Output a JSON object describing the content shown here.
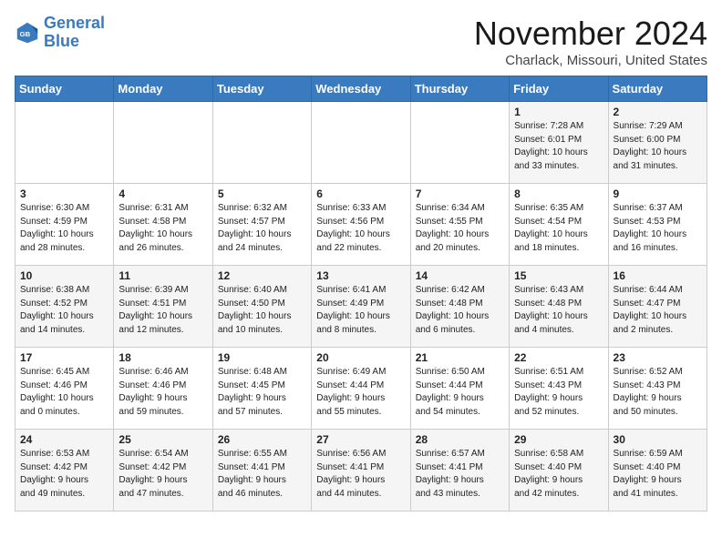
{
  "logo": {
    "line1": "General",
    "line2": "Blue"
  },
  "title": "November 2024",
  "location": "Charlack, Missouri, United States",
  "days_of_week": [
    "Sunday",
    "Monday",
    "Tuesday",
    "Wednesday",
    "Thursday",
    "Friday",
    "Saturday"
  ],
  "weeks": [
    [
      {
        "day": "",
        "info": ""
      },
      {
        "day": "",
        "info": ""
      },
      {
        "day": "",
        "info": ""
      },
      {
        "day": "",
        "info": ""
      },
      {
        "day": "",
        "info": ""
      },
      {
        "day": "1",
        "info": "Sunrise: 7:28 AM\nSunset: 6:01 PM\nDaylight: 10 hours\nand 33 minutes."
      },
      {
        "day": "2",
        "info": "Sunrise: 7:29 AM\nSunset: 6:00 PM\nDaylight: 10 hours\nand 31 minutes."
      }
    ],
    [
      {
        "day": "3",
        "info": "Sunrise: 6:30 AM\nSunset: 4:59 PM\nDaylight: 10 hours\nand 28 minutes."
      },
      {
        "day": "4",
        "info": "Sunrise: 6:31 AM\nSunset: 4:58 PM\nDaylight: 10 hours\nand 26 minutes."
      },
      {
        "day": "5",
        "info": "Sunrise: 6:32 AM\nSunset: 4:57 PM\nDaylight: 10 hours\nand 24 minutes."
      },
      {
        "day": "6",
        "info": "Sunrise: 6:33 AM\nSunset: 4:56 PM\nDaylight: 10 hours\nand 22 minutes."
      },
      {
        "day": "7",
        "info": "Sunrise: 6:34 AM\nSunset: 4:55 PM\nDaylight: 10 hours\nand 20 minutes."
      },
      {
        "day": "8",
        "info": "Sunrise: 6:35 AM\nSunset: 4:54 PM\nDaylight: 10 hours\nand 18 minutes."
      },
      {
        "day": "9",
        "info": "Sunrise: 6:37 AM\nSunset: 4:53 PM\nDaylight: 10 hours\nand 16 minutes."
      }
    ],
    [
      {
        "day": "10",
        "info": "Sunrise: 6:38 AM\nSunset: 4:52 PM\nDaylight: 10 hours\nand 14 minutes."
      },
      {
        "day": "11",
        "info": "Sunrise: 6:39 AM\nSunset: 4:51 PM\nDaylight: 10 hours\nand 12 minutes."
      },
      {
        "day": "12",
        "info": "Sunrise: 6:40 AM\nSunset: 4:50 PM\nDaylight: 10 hours\nand 10 minutes."
      },
      {
        "day": "13",
        "info": "Sunrise: 6:41 AM\nSunset: 4:49 PM\nDaylight: 10 hours\nand 8 minutes."
      },
      {
        "day": "14",
        "info": "Sunrise: 6:42 AM\nSunset: 4:48 PM\nDaylight: 10 hours\nand 6 minutes."
      },
      {
        "day": "15",
        "info": "Sunrise: 6:43 AM\nSunset: 4:48 PM\nDaylight: 10 hours\nand 4 minutes."
      },
      {
        "day": "16",
        "info": "Sunrise: 6:44 AM\nSunset: 4:47 PM\nDaylight: 10 hours\nand 2 minutes."
      }
    ],
    [
      {
        "day": "17",
        "info": "Sunrise: 6:45 AM\nSunset: 4:46 PM\nDaylight: 10 hours\nand 0 minutes."
      },
      {
        "day": "18",
        "info": "Sunrise: 6:46 AM\nSunset: 4:46 PM\nDaylight: 9 hours\nand 59 minutes."
      },
      {
        "day": "19",
        "info": "Sunrise: 6:48 AM\nSunset: 4:45 PM\nDaylight: 9 hours\nand 57 minutes."
      },
      {
        "day": "20",
        "info": "Sunrise: 6:49 AM\nSunset: 4:44 PM\nDaylight: 9 hours\nand 55 minutes."
      },
      {
        "day": "21",
        "info": "Sunrise: 6:50 AM\nSunset: 4:44 PM\nDaylight: 9 hours\nand 54 minutes."
      },
      {
        "day": "22",
        "info": "Sunrise: 6:51 AM\nSunset: 4:43 PM\nDaylight: 9 hours\nand 52 minutes."
      },
      {
        "day": "23",
        "info": "Sunrise: 6:52 AM\nSunset: 4:43 PM\nDaylight: 9 hours\nand 50 minutes."
      }
    ],
    [
      {
        "day": "24",
        "info": "Sunrise: 6:53 AM\nSunset: 4:42 PM\nDaylight: 9 hours\nand 49 minutes."
      },
      {
        "day": "25",
        "info": "Sunrise: 6:54 AM\nSunset: 4:42 PM\nDaylight: 9 hours\nand 47 minutes."
      },
      {
        "day": "26",
        "info": "Sunrise: 6:55 AM\nSunset: 4:41 PM\nDaylight: 9 hours\nand 46 minutes."
      },
      {
        "day": "27",
        "info": "Sunrise: 6:56 AM\nSunset: 4:41 PM\nDaylight: 9 hours\nand 44 minutes."
      },
      {
        "day": "28",
        "info": "Sunrise: 6:57 AM\nSunset: 4:41 PM\nDaylight: 9 hours\nand 43 minutes."
      },
      {
        "day": "29",
        "info": "Sunrise: 6:58 AM\nSunset: 4:40 PM\nDaylight: 9 hours\nand 42 minutes."
      },
      {
        "day": "30",
        "info": "Sunrise: 6:59 AM\nSunset: 4:40 PM\nDaylight: 9 hours\nand 41 minutes."
      }
    ]
  ]
}
